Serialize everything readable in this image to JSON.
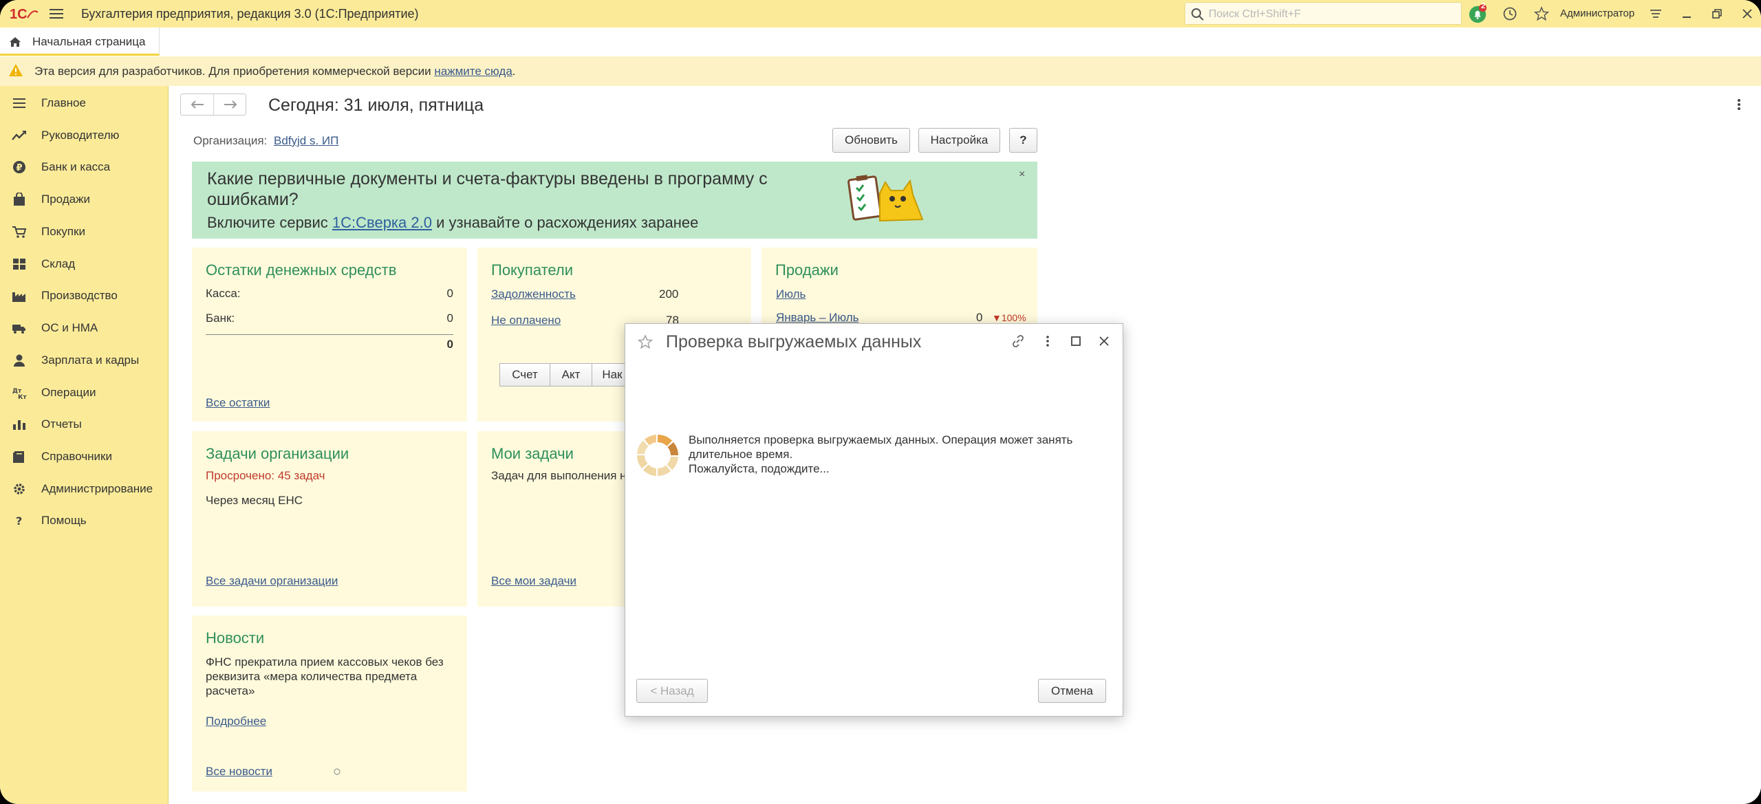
{
  "app": {
    "title": "Бухгалтерия предприятия, редакция 3.0  (1С:Предприятие)",
    "search_placeholder": "Поиск Ctrl+Shift+F",
    "notifications_count": "2",
    "user": "Администратор",
    "accent": "#fbeb99"
  },
  "tabs": {
    "home": "Начальная страница"
  },
  "notice": {
    "text": "Эта версия для разработчиков. Для приобретения коммерческой версии ",
    "link": "нажмите сюда",
    "after": "."
  },
  "sidebar": {
    "items": [
      {
        "label": "Главное",
        "icon": "menu-lines-icon"
      },
      {
        "label": "Руководителю",
        "icon": "trend-icon"
      },
      {
        "label": "Банк и касса",
        "icon": "ruble-icon"
      },
      {
        "label": "Продажи",
        "icon": "bag-icon"
      },
      {
        "label": "Покупки",
        "icon": "cart-icon"
      },
      {
        "label": "Склад",
        "icon": "grid-icon"
      },
      {
        "label": "Производство",
        "icon": "factory-icon"
      },
      {
        "label": "ОС и НМА",
        "icon": "truck-icon"
      },
      {
        "label": "Зарплата и кадры",
        "icon": "person-icon"
      },
      {
        "label": "Операции",
        "icon": "dtkt-icon"
      },
      {
        "label": "Отчеты",
        "icon": "bar-chart-icon"
      },
      {
        "label": "Справочники",
        "icon": "book-icon"
      },
      {
        "label": "Администрирование",
        "icon": "gear-icon"
      },
      {
        "label": "Помощь",
        "icon": "question-icon"
      }
    ]
  },
  "main": {
    "title": "Сегодня: 31 июля, пятница",
    "org_label": "Организация:",
    "org_value": "Bdfyjd s. ИП",
    "refresh": "Обновить",
    "settings": "Настройка",
    "help": "?"
  },
  "banner": {
    "line1": "Какие первичные документы и счета-фактуры введены в программу с ошибками?",
    "line2_pre": "Включите сервис ",
    "line2_link": "1С:Сверка 2.0",
    "line2_post": " и узнавайте о расхождениях заранее",
    "close": "×"
  },
  "cash": {
    "title": "Остатки денежных средств",
    "kassa_label": "Касса:",
    "kassa_value": "0",
    "bank_label": "Банк:",
    "bank_value": "0",
    "total": "0",
    "link": "Все остатки"
  },
  "buyers": {
    "title": "Покупатели",
    "debt_label": "Задолженность",
    "debt_value": "200",
    "unpaid_label": "Не оплачено",
    "unpaid_value": "78",
    "seg": [
      "Счет",
      "Акт",
      "Нак"
    ]
  },
  "sales": {
    "title": "Продажи",
    "month": "Июль",
    "period_label": "Январь – Июль",
    "period_value": "0",
    "period_change": "▼100%"
  },
  "org_tasks": {
    "title": "Задачи организации",
    "overdue": "Просрочено: 45 задач",
    "next": "Через месяц ЕНС",
    "link": "Все задачи организации"
  },
  "my_tasks": {
    "title": "Мои задачи",
    "text": "Задач для выполнения н",
    "link": "Все мои задачи"
  },
  "news": {
    "title": "Новости",
    "text": "ФНС прекратила прием кассовых чеков без реквизита «мера количества предмета расчета»",
    "more": "Подробнее",
    "all": "Все новости"
  },
  "modal": {
    "title": "Проверка выгружаемых данных",
    "msg1": "Выполняется проверка выгружаемых данных. Операция может занять длительное время.",
    "msg2": "Пожалуйста, подождите...",
    "back": "< Назад",
    "cancel": "Отмена"
  }
}
